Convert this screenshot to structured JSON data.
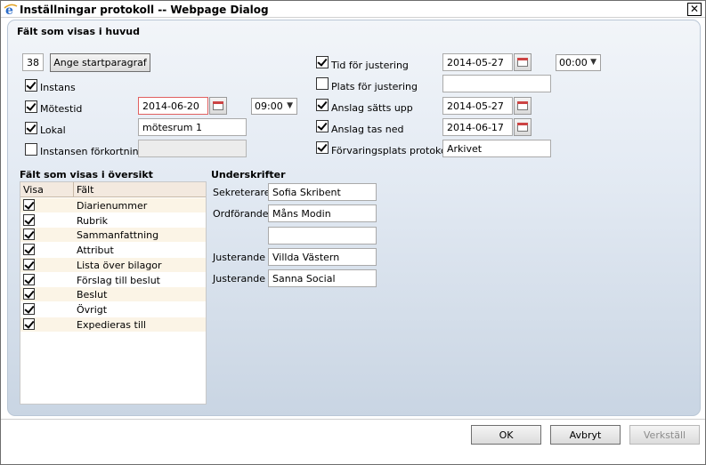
{
  "window": {
    "title": "Inställningar protokoll -- Webpage Dialog",
    "close_label": "✕"
  },
  "header_section": {
    "title": "Fält som visas i huvud",
    "para_number": "38",
    "start_para_button": "Ange startparagraf",
    "instans_label": "Instans",
    "motestid_label": "Mötestid",
    "motestid_date": "2014-06-20",
    "motestid_time": "09:00",
    "lokal_label": "Lokal",
    "lokal_value": "mötesrum 1",
    "forkortning_label": "Instansen förkortning",
    "forkortning_value": "",
    "tid_justering_label": "Tid för justering",
    "tid_justering_date": "2014-05-27",
    "tid_justering_time": "00:00",
    "plats_justering_label": "Plats för justering",
    "plats_justering_value": "",
    "anslag_upp_label": "Anslag sätts upp",
    "anslag_upp_date": "2014-05-27",
    "anslag_ned_label": "Anslag tas ned",
    "anslag_ned_date": "2014-06-17",
    "forvaring_label": "Förvaringsplats protokoll",
    "forvaring_value": "Arkivet"
  },
  "overview": {
    "title": "Fält som visas i översikt",
    "col_visa": "Visa",
    "col_falt": "Fält",
    "rows": [
      {
        "label": "Diarienummer",
        "checked": true
      },
      {
        "label": "Rubrik",
        "checked": true
      },
      {
        "label": "Sammanfattning",
        "checked": true
      },
      {
        "label": "Attribut",
        "checked": true
      },
      {
        "label": "Lista över bilagor",
        "checked": true
      },
      {
        "label": "Förslag till beslut",
        "checked": true
      },
      {
        "label": "Beslut",
        "checked": true
      },
      {
        "label": "Övrigt",
        "checked": true
      },
      {
        "label": "Expedieras till",
        "checked": true
      }
    ]
  },
  "signatures": {
    "title": "Underskrifter",
    "rows": [
      {
        "role": "Sekreterare",
        "name": "Sofia Skribent"
      },
      {
        "role": "Ordförande",
        "name": "Måns Modin"
      },
      {
        "role": "",
        "name": ""
      },
      {
        "role": "Justerande",
        "name": "Villda Västern"
      },
      {
        "role": "Justerande",
        "name": "Sanna Social"
      }
    ]
  },
  "footer": {
    "ok": "OK",
    "cancel": "Avbryt",
    "apply": "Verkställ"
  }
}
